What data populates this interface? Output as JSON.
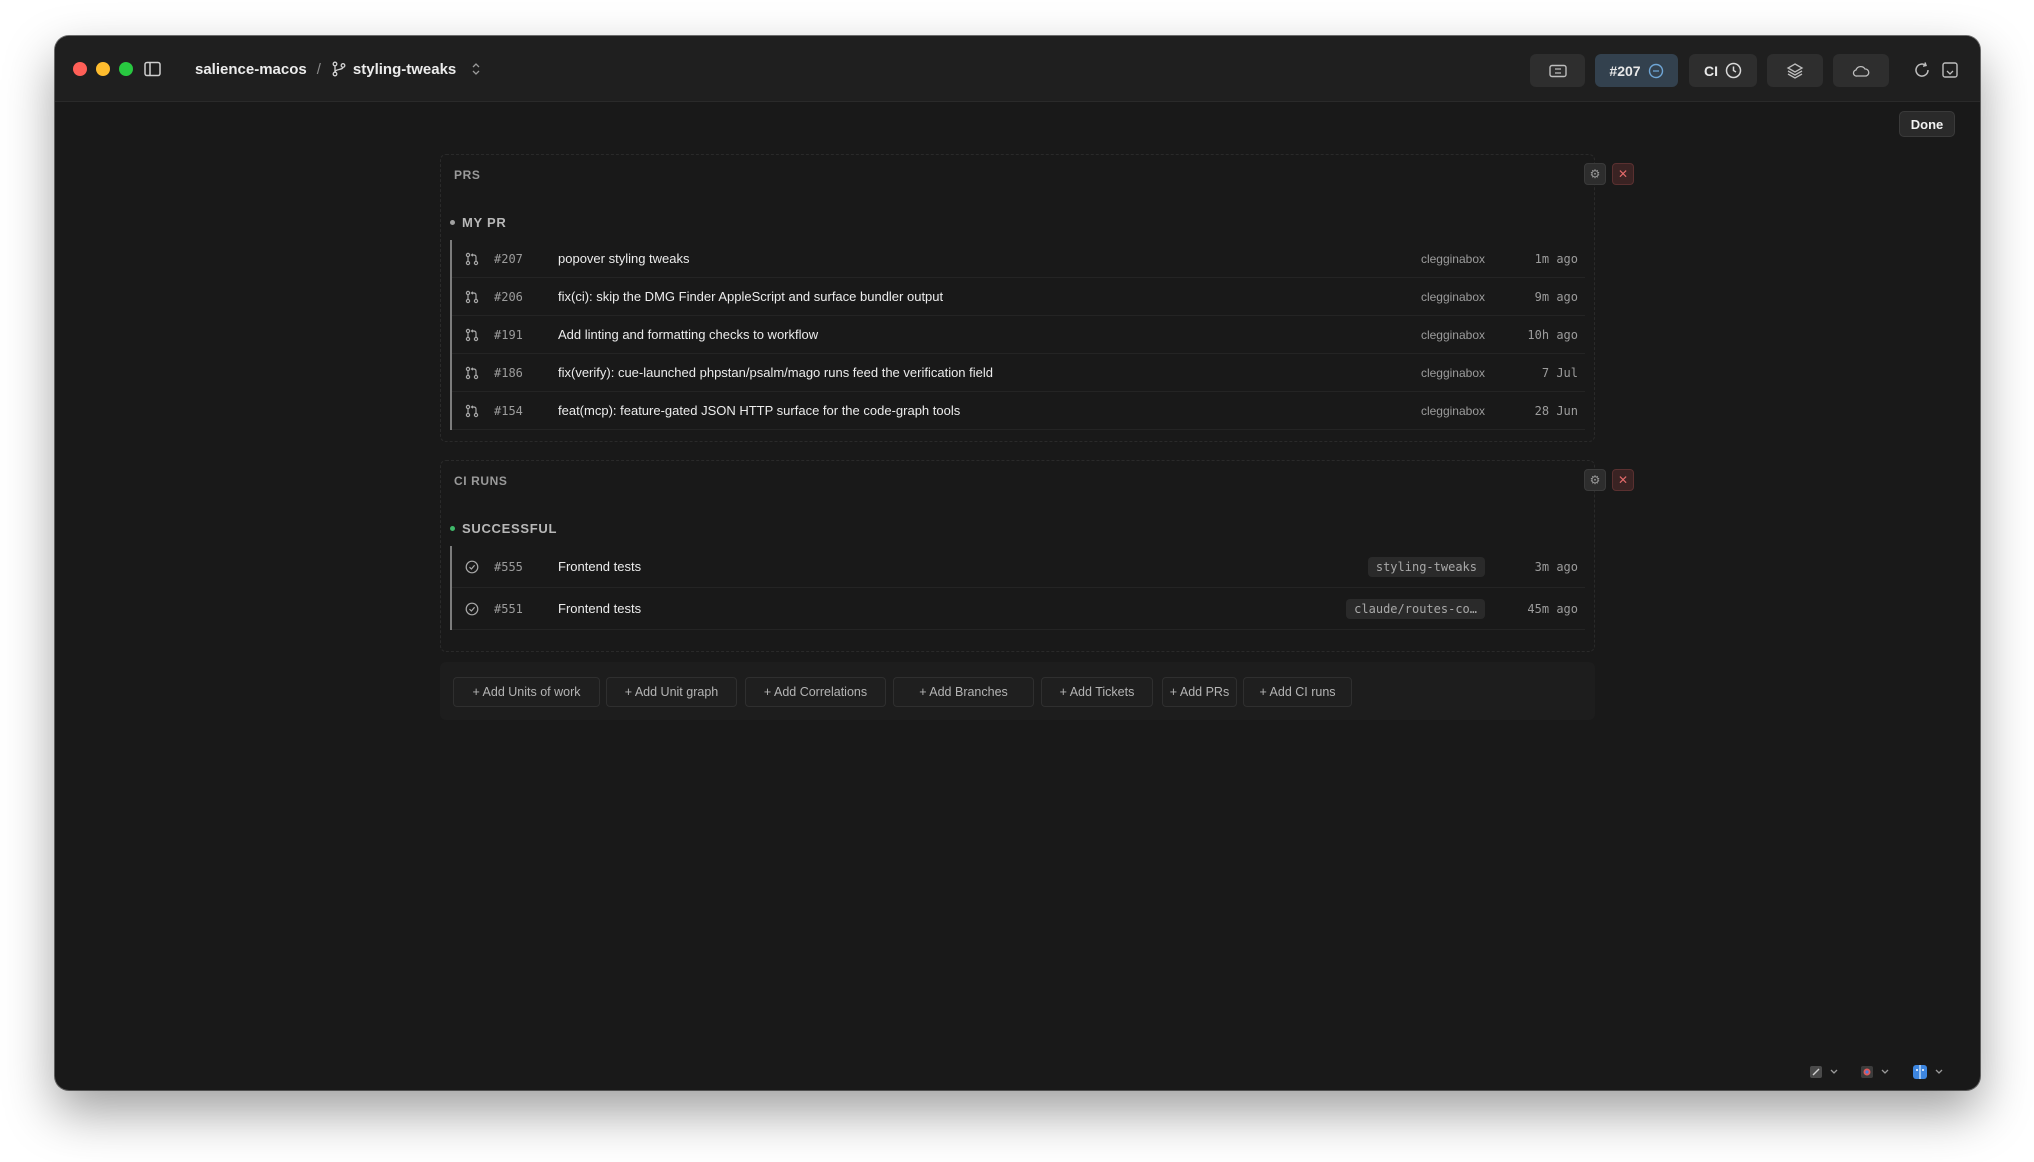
{
  "titlebar": {
    "repo": "salience-macos",
    "separator": "/",
    "branch": "styling-tweaks",
    "pr_button_label": "#207",
    "ci_button_label": "CI"
  },
  "done_label": "Done",
  "panels": {
    "prs": {
      "title": "PRS",
      "group_label": "MY PR",
      "group_dot_color": "#a0a0a0",
      "rows": [
        {
          "num": "#207",
          "title": "popover styling tweaks",
          "author": "clegginabox",
          "time": "1m ago"
        },
        {
          "num": "#206",
          "title": "fix(ci): skip the DMG Finder AppleScript and surface bundler output",
          "author": "clegginabox",
          "time": "9m ago"
        },
        {
          "num": "#191",
          "title": "Add linting and formatting checks to workflow",
          "author": "clegginabox",
          "time": "10h ago"
        },
        {
          "num": "#186",
          "title": "fix(verify): cue-launched phpstan/psalm/mago runs feed the verification field",
          "author": "clegginabox",
          "time": "7 Jul"
        },
        {
          "num": "#154",
          "title": "feat(mcp): feature-gated JSON HTTP surface for the code-graph tools",
          "author": "clegginabox",
          "time": "28 Jun"
        }
      ]
    },
    "ci": {
      "title": "CI RUNS",
      "group_label": "SUCCESSFUL",
      "group_dot_color": "#3fb96a",
      "rows": [
        {
          "num": "#555",
          "title": "Frontend tests",
          "branch": "styling-tweaks",
          "time": "3m ago"
        },
        {
          "num": "#551",
          "title": "Frontend tests",
          "branch": "claude/routes-co…",
          "time": "45m ago"
        }
      ]
    }
  },
  "add_buttons": [
    "+ Add Units of work",
    "+ Add Unit graph",
    "+ Add Correlations",
    "+ Add Branches",
    "+ Add Tickets",
    "+ Add PRs",
    "+ Add CI runs"
  ],
  "colors": {
    "window_bg": "#191919",
    "accent_pr_button": "#33414e",
    "close_red": "#e26a6a",
    "success_green": "#3fb96a"
  },
  "icons": {
    "pr_row": "git-pull-request-icon",
    "ci_row": "ci-run-icon",
    "branch": "git-branch-icon"
  }
}
